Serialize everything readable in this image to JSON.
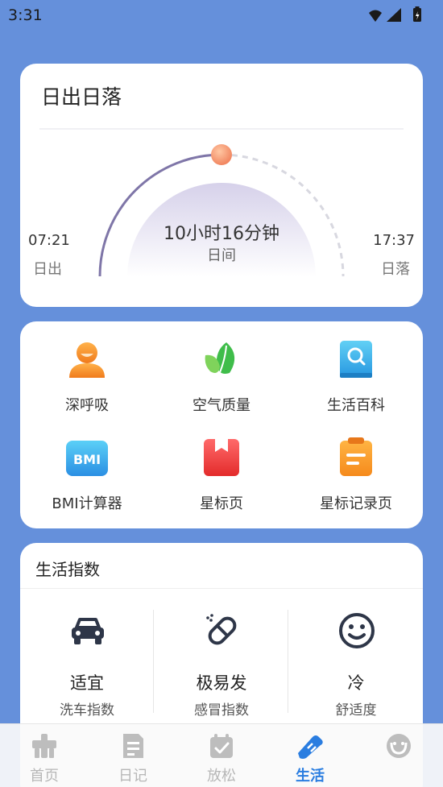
{
  "status_bar": {
    "time": "3:31"
  },
  "sun_card": {
    "title": "日出日落",
    "sunrise_time": "07:21",
    "sunrise_label": "日出",
    "sunset_time": "17:37",
    "sunset_label": "日落",
    "duration": "10小时16分钟",
    "duration_label": "日间"
  },
  "tools": [
    {
      "label": "深呼吸",
      "icon": "person-icon"
    },
    {
      "label": "空气质量",
      "icon": "leaf-icon"
    },
    {
      "label": "生活百科",
      "icon": "book-search-icon"
    },
    {
      "label": "BMI计算器",
      "icon": "bmi-icon"
    },
    {
      "label": "星标页",
      "icon": "bookmark-icon"
    },
    {
      "label": "星标记录页",
      "icon": "notepad-icon"
    }
  ],
  "life_index": {
    "title": "生活指数",
    "items": [
      {
        "value": "适宜",
        "name": "洗车指数",
        "icon": "car-icon"
      },
      {
        "value": "极易发",
        "name": "感冒指数",
        "icon": "pill-icon"
      },
      {
        "value": "冷",
        "name": "舒适度",
        "icon": "smiley-icon"
      }
    ]
  },
  "bottom_nav": {
    "active": "生活",
    "items": [
      {
        "label": "首页",
        "icon": "home-icon"
      },
      {
        "label": "日记",
        "icon": "diary-icon"
      },
      {
        "label": "放松",
        "icon": "calendar-check-icon"
      },
      {
        "label": "生活",
        "icon": "shoe-icon"
      },
      {
        "label": "",
        "icon": "profile-icon"
      }
    ]
  },
  "colors": {
    "background": "#6590db",
    "accent": "#2a7de0",
    "arc": "#7f76a8",
    "sun": "#f08a5d"
  }
}
